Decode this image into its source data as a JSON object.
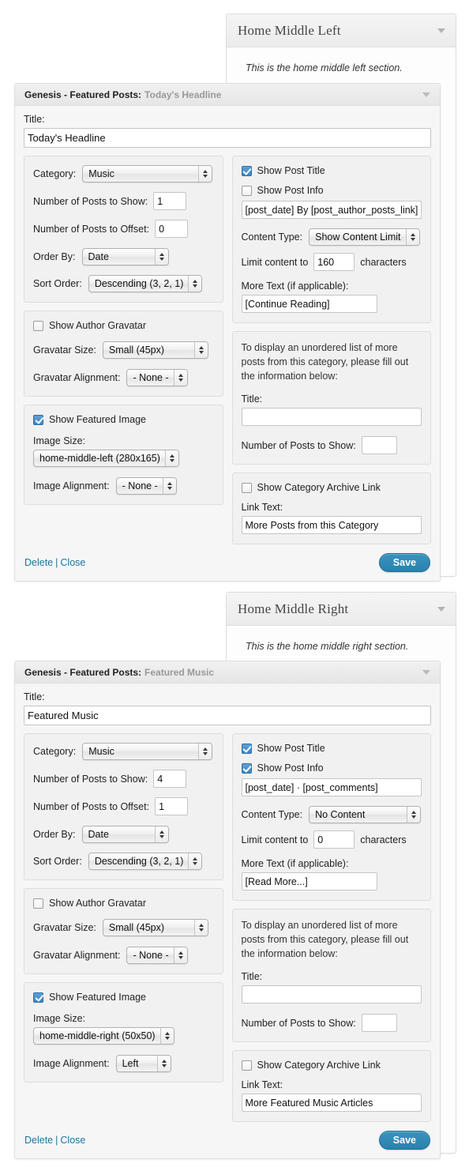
{
  "sections": [
    {
      "panel_title": "Home Middle Left",
      "panel_description": "This is the home middle left section.",
      "widget": {
        "name": "Genesis - Featured Posts",
        "colon": ":",
        "instance": "Today's Headline",
        "title_label": "Title:",
        "title_value": "Today's Headline",
        "category_label": "Category:",
        "category_value": "Music",
        "posts_show_label": "Number of Posts to Show:",
        "posts_show_value": "1",
        "posts_offset_label": "Number of Posts to Offset:",
        "posts_offset_value": "0",
        "order_by_label": "Order By:",
        "order_by_value": "Date",
        "sort_order_label": "Sort Order:",
        "sort_order_value": "Descending (3, 2, 1)",
        "show_gravatar_label": "Show Author Gravatar",
        "show_gravatar_checked": false,
        "gravatar_size_label": "Gravatar Size:",
        "gravatar_size_value": "Small (45px)",
        "gravatar_align_label": "Gravatar Alignment:",
        "gravatar_align_value": "- None -",
        "show_image_label": "Show Featured Image",
        "show_image_checked": true,
        "image_size_label": "Image Size:",
        "image_size_value": "home-middle-left (280x165)",
        "image_align_label": "Image Alignment:",
        "image_align_value": "- None -",
        "show_post_title_label": "Show Post Title",
        "show_post_title_checked": true,
        "show_post_info_label": "Show Post Info",
        "show_post_info_checked": false,
        "post_info_value": "[post_date] By [post_author_posts_link] [post_comments]",
        "content_type_label": "Content Type:",
        "content_type_value": "Show Content Limit",
        "limit_prefix": "Limit content to",
        "limit_value": "160",
        "limit_suffix": "characters",
        "more_text_label": "More Text (if applicable):",
        "more_text_value": "[Continue Reading]",
        "more_posts_help": "To display an unordered list of more posts from this category, please fill out the information below:",
        "more_title_label": "Title:",
        "more_title_value": "",
        "more_posts_show_label": "Number of Posts to Show:",
        "more_posts_show_value": "",
        "show_archive_link_label": "Show Category Archive Link",
        "show_archive_link_checked": false,
        "link_text_label": "Link Text:",
        "link_text_value": "More Posts from this Category",
        "delete_label": "Delete",
        "separator": "|",
        "close_label": "Close",
        "save_label": "Save"
      }
    },
    {
      "panel_title": "Home Middle Right",
      "panel_description": "This is the home middle right section.",
      "widget": {
        "name": "Genesis - Featured Posts",
        "colon": ":",
        "instance": "Featured Music",
        "title_label": "Title:",
        "title_value": "Featured Music",
        "category_label": "Category:",
        "category_value": "Music",
        "posts_show_label": "Number of Posts to Show:",
        "posts_show_value": "4",
        "posts_offset_label": "Number of Posts to Offset:",
        "posts_offset_value": "1",
        "order_by_label": "Order By:",
        "order_by_value": "Date",
        "sort_order_label": "Sort Order:",
        "sort_order_value": "Descending (3, 2, 1)",
        "show_gravatar_label": "Show Author Gravatar",
        "show_gravatar_checked": false,
        "gravatar_size_label": "Gravatar Size:",
        "gravatar_size_value": "Small (45px)",
        "gravatar_align_label": "Gravatar Alignment:",
        "gravatar_align_value": "- None -",
        "show_image_label": "Show Featured Image",
        "show_image_checked": true,
        "image_size_label": "Image Size:",
        "image_size_value": "home-middle-right (50x50)",
        "image_align_label": "Image Alignment:",
        "image_align_value": "Left",
        "show_post_title_label": "Show Post Title",
        "show_post_title_checked": true,
        "show_post_info_label": "Show Post Info",
        "show_post_info_checked": true,
        "post_info_value": "[post_date] · [post_comments]",
        "content_type_label": "Content Type:",
        "content_type_value": "No Content",
        "limit_prefix": "Limit content to",
        "limit_value": "0",
        "limit_suffix": "characters",
        "more_text_label": "More Text (if applicable):",
        "more_text_value": "[Read More...]",
        "more_posts_help": "To display an unordered list of more posts from this category, please fill out the information below:",
        "more_title_label": "Title:",
        "more_title_value": "",
        "more_posts_show_label": "Number of Posts to Show:",
        "more_posts_show_value": "",
        "show_archive_link_label": "Show Category Archive Link",
        "show_archive_link_checked": false,
        "link_text_label": "Link Text:",
        "link_text_value": "More Featured Music Articles",
        "delete_label": "Delete",
        "separator": "|",
        "close_label": "Close",
        "save_label": "Save"
      }
    }
  ]
}
